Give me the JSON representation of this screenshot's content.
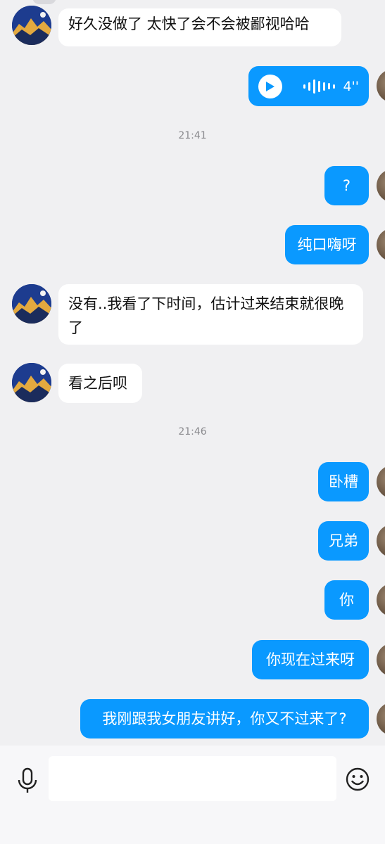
{
  "messages": [
    {
      "side": "in",
      "text": "好久没做了 太快了会不会被鄙视哈哈"
    },
    {
      "side": "out",
      "type": "voice",
      "duration": "4''"
    },
    {
      "side": "time",
      "text": "21:41"
    },
    {
      "side": "out",
      "text": "?"
    },
    {
      "side": "out",
      "text": "纯口嗨呀"
    },
    {
      "side": "in",
      "text": "没有..我看了下时间，估计过来结束就很晚了"
    },
    {
      "side": "in",
      "text": "看之后呗"
    },
    {
      "side": "time",
      "text": "21:46"
    },
    {
      "side": "out",
      "text": "卧槽"
    },
    {
      "side": "out",
      "text": "兄弟"
    },
    {
      "side": "out",
      "text": "你"
    },
    {
      "side": "out",
      "text": "你现在过来呀"
    },
    {
      "side": "out",
      "text": "我刚跟我女朋友讲好，你又不过来了?"
    }
  ],
  "icons": {
    "voice_input": "microphone-icon",
    "emoji": "smiley-icon",
    "play": "play-icon",
    "waveform": "audio-waveform-icon"
  },
  "colors": {
    "background": "#f0f0f2",
    "outgoing_bubble": "#0a99ff",
    "incoming_bubble": "#ffffff",
    "timestamp": "#8a8a8e"
  }
}
